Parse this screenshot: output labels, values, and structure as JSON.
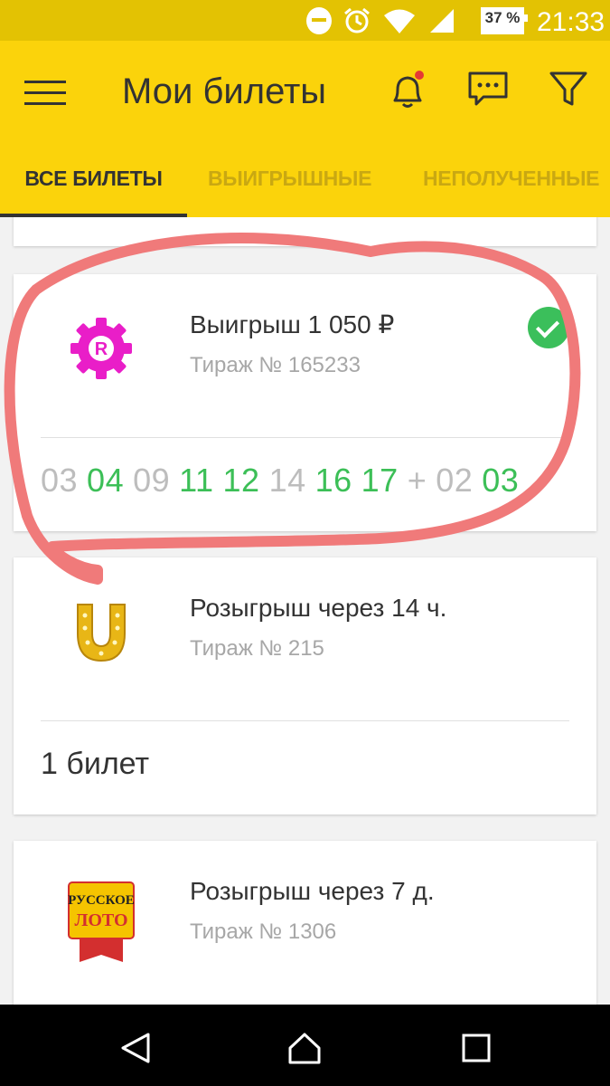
{
  "status_bar": {
    "battery": "37 %",
    "time": "21:33",
    "icons": [
      "do-not-disturb-icon",
      "alarm-icon",
      "wifi-icon",
      "signal-icon",
      "battery-icon"
    ]
  },
  "app_bar": {
    "title": "Мои билеты",
    "icons": [
      "menu-icon",
      "bell-icon",
      "chat-icon",
      "filter-icon"
    ]
  },
  "tabs": [
    {
      "label": "ВСЕ БИЛЕТЫ",
      "active": true
    },
    {
      "label": "ВЫИГРЫШНЫЕ",
      "active": false
    },
    {
      "label": "НЕПОЛУЧЕННЫЕ",
      "active": false
    }
  ],
  "cards": [
    {
      "logo": "pink-chip-logo",
      "title": "Выигрыш 1 050 ₽",
      "draw": "Тираж № 165233",
      "status_icon": "check-icon",
      "numbers": [
        {
          "value": "03",
          "hit": false
        },
        {
          "value": "04",
          "hit": true
        },
        {
          "value": "09",
          "hit": false
        },
        {
          "value": "11",
          "hit": true
        },
        {
          "value": "12",
          "hit": true
        },
        {
          "value": "14",
          "hit": false
        },
        {
          "value": "16",
          "hit": true
        },
        {
          "value": "17",
          "hit": true
        },
        {
          "value": "+",
          "hit": false
        },
        {
          "value": "02",
          "hit": false
        },
        {
          "value": "03",
          "hit": true
        }
      ]
    },
    {
      "logo": "horseshoe-logo",
      "title": "Розыгрыш через 14 ч.",
      "draw": "Тираж № 215",
      "tickets": "1 билет"
    },
    {
      "logo": "russkoe-loto-logo",
      "logo_text": [
        "РУССКОЕ",
        "ЛОТО"
      ],
      "title": "Розыгрыш через 7 д.",
      "draw": "Тираж № 1306"
    }
  ],
  "colors": {
    "app_bar": "#fbd30b",
    "status_bar": "#e3c203",
    "hit_number": "#3cbf57",
    "miss_number": "#bdbdbd",
    "annotation": "#f07a7a"
  },
  "nav_bar": {
    "icons": [
      "back-icon",
      "home-icon",
      "recent-apps-icon"
    ]
  }
}
